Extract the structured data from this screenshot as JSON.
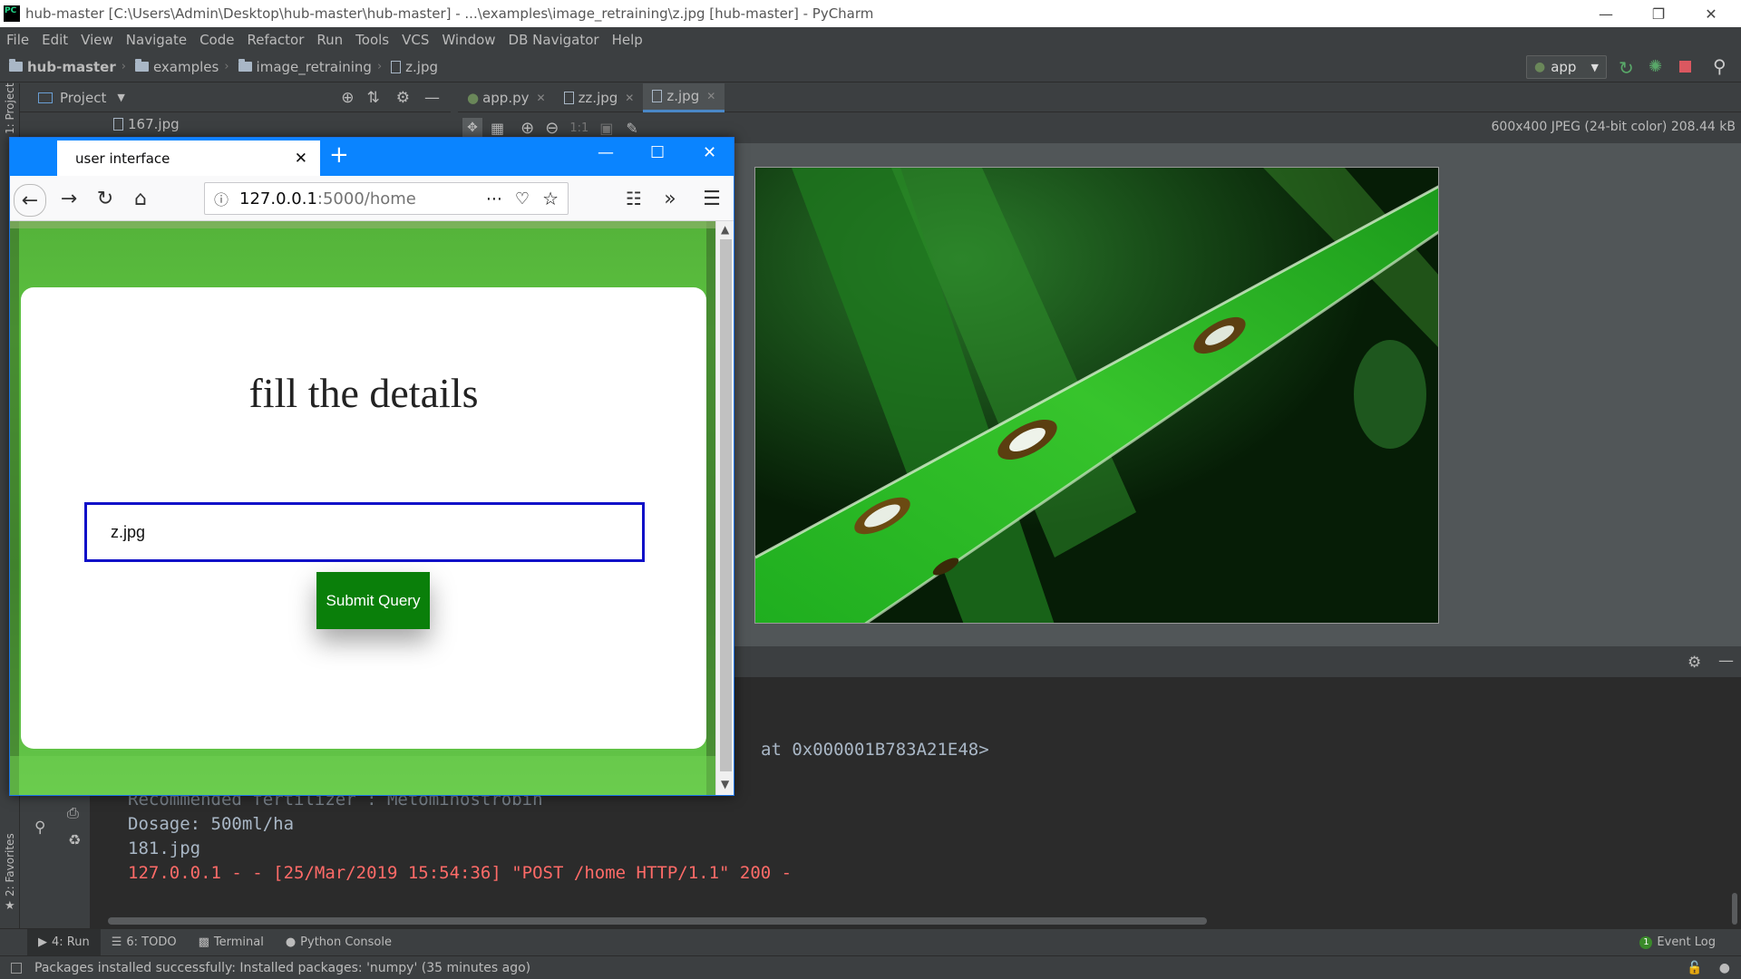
{
  "window": {
    "title": "hub-master [C:\\Users\\Admin\\Desktop\\hub-master\\hub-master] - ...\\examples\\image_retraining\\z.jpg [hub-master] - PyCharm",
    "logo": "PC"
  },
  "menu": [
    "File",
    "Edit",
    "View",
    "Navigate",
    "Code",
    "Refactor",
    "Run",
    "Tools",
    "VCS",
    "Window",
    "DB Navigator",
    "Help"
  ],
  "breadcrumb": [
    "hub-master",
    "examples",
    "image_retraining",
    "z.jpg"
  ],
  "run_config": "app",
  "project_panel": {
    "title": "Project",
    "tree_item": "167.jpg"
  },
  "left_strip": {
    "top": "1: Project",
    "bottom": "2: Favorites"
  },
  "editor_tabs": [
    {
      "label": "app.py"
    },
    {
      "label": "zz.jpg"
    },
    {
      "label": "z.jpg"
    }
  ],
  "image_info": "600x400 JPEG (24-bit color) 208.44 kB",
  "image_toolbar": {
    "zoom_actual": "1:1"
  },
  "console": {
    "lines": [
      {
        "text": "at 0x000001B783A21E48>",
        "type": "normal"
      },
      {
        "text": "Recommended fertilizer : Metominostrobin",
        "type": "normal"
      },
      {
        "text": "Dosage: 500ml/ha",
        "type": "normal"
      },
      {
        "text": "181.jpg",
        "type": "normal"
      },
      {
        "text": "127.0.0.1 - - [25/Mar/2019 15:54:36] \"POST /home HTTP/1.1\" 200 -",
        "type": "error"
      }
    ]
  },
  "bottom_tabs": [
    {
      "label": "4: Run"
    },
    {
      "label": "6: TODO"
    },
    {
      "label": "Terminal"
    },
    {
      "label": "Python Console"
    }
  ],
  "event_log": {
    "label": "Event Log",
    "count": "1"
  },
  "status_message": "Packages installed successfully: Installed packages: 'numpy' (35 minutes ago)",
  "browser": {
    "tab_title": "user interface",
    "url_host": "127.0.0.1",
    "url_rest": ":5000/home",
    "page": {
      "heading": "fill the details",
      "input_value": "z.jpg",
      "submit_label": "Submit Query"
    }
  },
  "colors": {
    "ide_bg": "#3c3f41",
    "console_bg": "#2b2b2b",
    "console_error": "#ff6b68",
    "firefox_blue": "#0a84ff",
    "submit_green": "#0a7f0a",
    "input_border": "#1010c8"
  }
}
